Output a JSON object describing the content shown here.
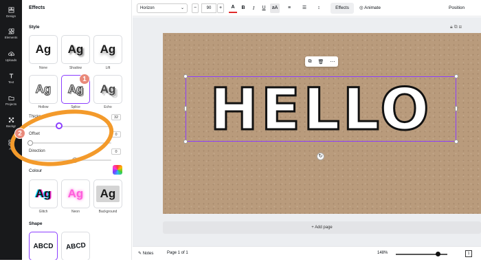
{
  "rail": {
    "items": [
      {
        "label": "Design",
        "icon": "design-icon"
      },
      {
        "label": "Elements",
        "icon": "elements-icon"
      },
      {
        "label": "Uploads",
        "icon": "uploads-icon"
      },
      {
        "label": "Text",
        "icon": "text-icon"
      },
      {
        "label": "Projects",
        "icon": "projects-icon"
      },
      {
        "label": "Backgr",
        "icon": "background-icon"
      },
      {
        "label": "Ap",
        "icon": "apps-icon"
      }
    ]
  },
  "panel": {
    "title": "Effects",
    "style_title": "Style",
    "styles": [
      {
        "label": "None"
      },
      {
        "label": "Shadow"
      },
      {
        "label": "Lift"
      },
      {
        "label": "Hollow"
      },
      {
        "label": "Splice"
      },
      {
        "label": "Echo"
      },
      {
        "label": "Glitch"
      },
      {
        "label": "Neon"
      },
      {
        "label": "Background"
      }
    ],
    "tile_text": "Ag",
    "selected_style": "Splice",
    "sliders": [
      {
        "label": "Thickness",
        "value": "32",
        "fraction": 0.3
      },
      {
        "label": "Offset",
        "value": "0",
        "fraction": 0.0
      },
      {
        "label": "Direction",
        "value": "0",
        "fraction": 0.47
      }
    ],
    "colour_title": "Colour",
    "shape_title": "Shape",
    "shapes": [
      {
        "label": "ABCD"
      },
      {
        "label": "ABCD"
      }
    ]
  },
  "toolbar": {
    "font": "Horizon",
    "font_size": "90",
    "minus": "−",
    "plus": "+",
    "effects": "Effects",
    "animate": "Animate",
    "position": "Position"
  },
  "canvas": {
    "text": "HELLO",
    "add_page": "+ Add page"
  },
  "bottom": {
    "notes": "Notes",
    "page_info": "Page 1 of 1",
    "zoom": "148%",
    "page_count": "1"
  },
  "annotations": {
    "marker1": "1",
    "marker2": "2"
  },
  "colors": {
    "accent": "#8b3dff",
    "annotation_ring": "#f39a2b",
    "canvas_bg": "#b99b7c"
  }
}
